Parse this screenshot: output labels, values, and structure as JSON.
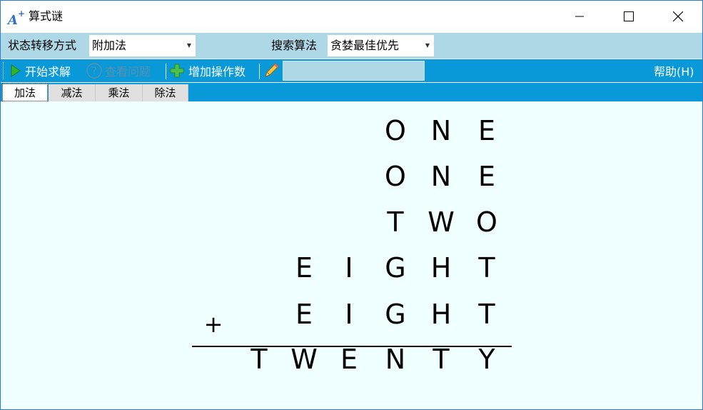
{
  "window": {
    "title": "算式谜",
    "icon": "a-plus-icon"
  },
  "controls": {
    "transfer_label": "状态转移方式",
    "transfer_value": "附加法",
    "search_label": "搜索算法",
    "search_value": "贪婪最佳优先"
  },
  "toolbar": {
    "start": "开始求解",
    "view": "查看问题",
    "add": "增加操作数",
    "help": "帮助(H)"
  },
  "tabs": [
    "加法",
    "减法",
    "乘法",
    "除法"
  ],
  "puzzle": {
    "operator": "+",
    "rows": [
      [
        "",
        "",
        "",
        "O",
        "N",
        "E"
      ],
      [
        "",
        "",
        "",
        "O",
        "N",
        "E"
      ],
      [
        "",
        "",
        "",
        "T",
        "W",
        "O"
      ],
      [
        "",
        "E",
        "I",
        "G",
        "H",
        "T"
      ],
      [
        "",
        "E",
        "I",
        "G",
        "H",
        "T"
      ],
      [
        "T",
        "W",
        "E",
        "N",
        "T",
        "Y"
      ]
    ]
  }
}
